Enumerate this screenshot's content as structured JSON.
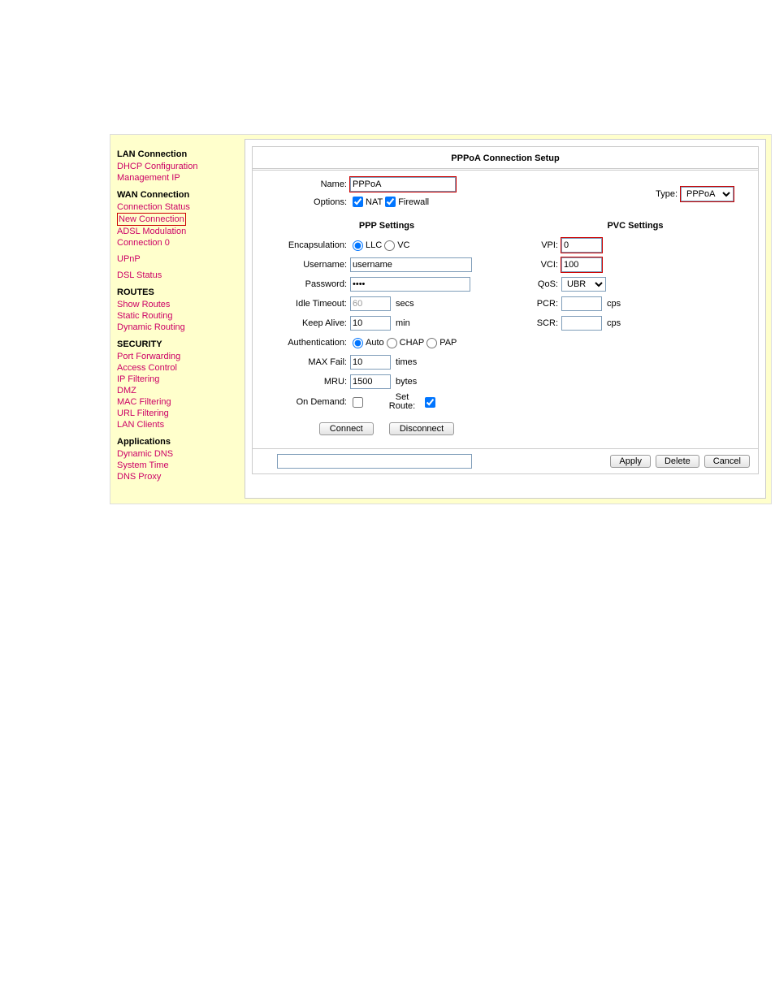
{
  "sidebar": {
    "lan_connection": {
      "heading": "LAN Connection",
      "items": [
        "DHCP Configuration",
        "Management IP"
      ]
    },
    "wan_connection": {
      "heading": "WAN Connection",
      "items": [
        "Connection Status",
        "New Connection",
        "ADSL Modulation",
        "Connection 0"
      ]
    },
    "upnp": "UPnP",
    "dsl_status": "DSL Status",
    "routes": {
      "heading": "ROUTES",
      "items": [
        "Show Routes",
        "Static Routing",
        "Dynamic Routing"
      ]
    },
    "security": {
      "heading": "SECURITY",
      "items": [
        "Port Forwarding",
        "Access Control",
        "IP Filtering",
        "DMZ",
        "MAC Filtering",
        "URL Filtering",
        "LAN Clients"
      ]
    },
    "applications": {
      "heading": "Applications",
      "items": [
        "Dynamic DNS",
        "System Time",
        "DNS Proxy"
      ]
    }
  },
  "panel": {
    "title": "PPPoA Connection Setup",
    "name_label": "Name:",
    "name_value": "PPPoA",
    "type_label": "Type:",
    "type_value": "PPPoA",
    "options_label": "Options:",
    "options": {
      "nat": "NAT",
      "firewall": "Firewall"
    },
    "ppp_heading": "PPP Settings",
    "pvc_heading": "PVC Settings",
    "ppp": {
      "encapsulation_label": "Encapsulation:",
      "encapsulation_llc": "LLC",
      "encapsulation_vc": "VC",
      "username_label": "Username:",
      "username_value": "username",
      "password_label": "Password:",
      "password_value": "••••",
      "idle_label": "Idle Timeout:",
      "idle_value": "60",
      "idle_unit": "secs",
      "keep_label": "Keep Alive:",
      "keep_value": "10",
      "keep_unit": "min",
      "auth_label": "Authentication:",
      "auth_auto": "Auto",
      "auth_chap": "CHAP",
      "auth_pap": "PAP",
      "maxfail_label": "MAX Fail:",
      "maxfail_value": "10",
      "maxfail_unit": "times",
      "mru_label": "MRU:",
      "mru_value": "1500",
      "mru_unit": "bytes",
      "ondemand_label": "On Demand:",
      "setroute_label": "Set Route:"
    },
    "pvc": {
      "vpi_label": "VPI:",
      "vpi_value": "0",
      "vci_label": "VCI:",
      "vci_value": "100",
      "qos_label": "QoS:",
      "qos_value": "UBR",
      "pcr_label": "PCR:",
      "pcr_value": "",
      "pcr_unit": "cps",
      "scr_label": "SCR:",
      "scr_value": "",
      "scr_unit": "cps"
    },
    "connect_btn": "Connect",
    "disconnect_btn": "Disconnect",
    "apply_btn": "Apply",
    "delete_btn": "Delete",
    "cancel_btn": "Cancel"
  }
}
